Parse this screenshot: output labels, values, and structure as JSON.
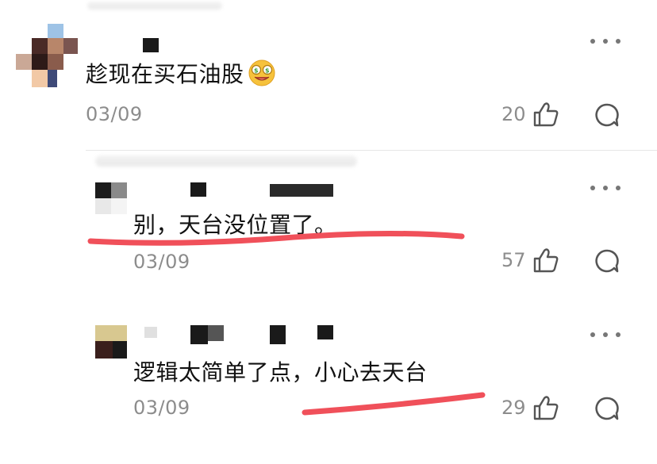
{
  "comments": [
    {
      "text": "趁现在买石油股",
      "emoji_icon": "hot-face-money-emoji-icon",
      "date": "03/09",
      "likes": "20"
    },
    {
      "text": "别，天台没位置了。",
      "date": "03/09",
      "likes": "57"
    },
    {
      "text": "逻辑太简单了点，小心去天台",
      "date": "03/09",
      "likes": "29"
    }
  ],
  "colors": {
    "annotation_underline": "#f0505a",
    "meta_text": "#8c8c8c",
    "body_text": "#111111"
  }
}
